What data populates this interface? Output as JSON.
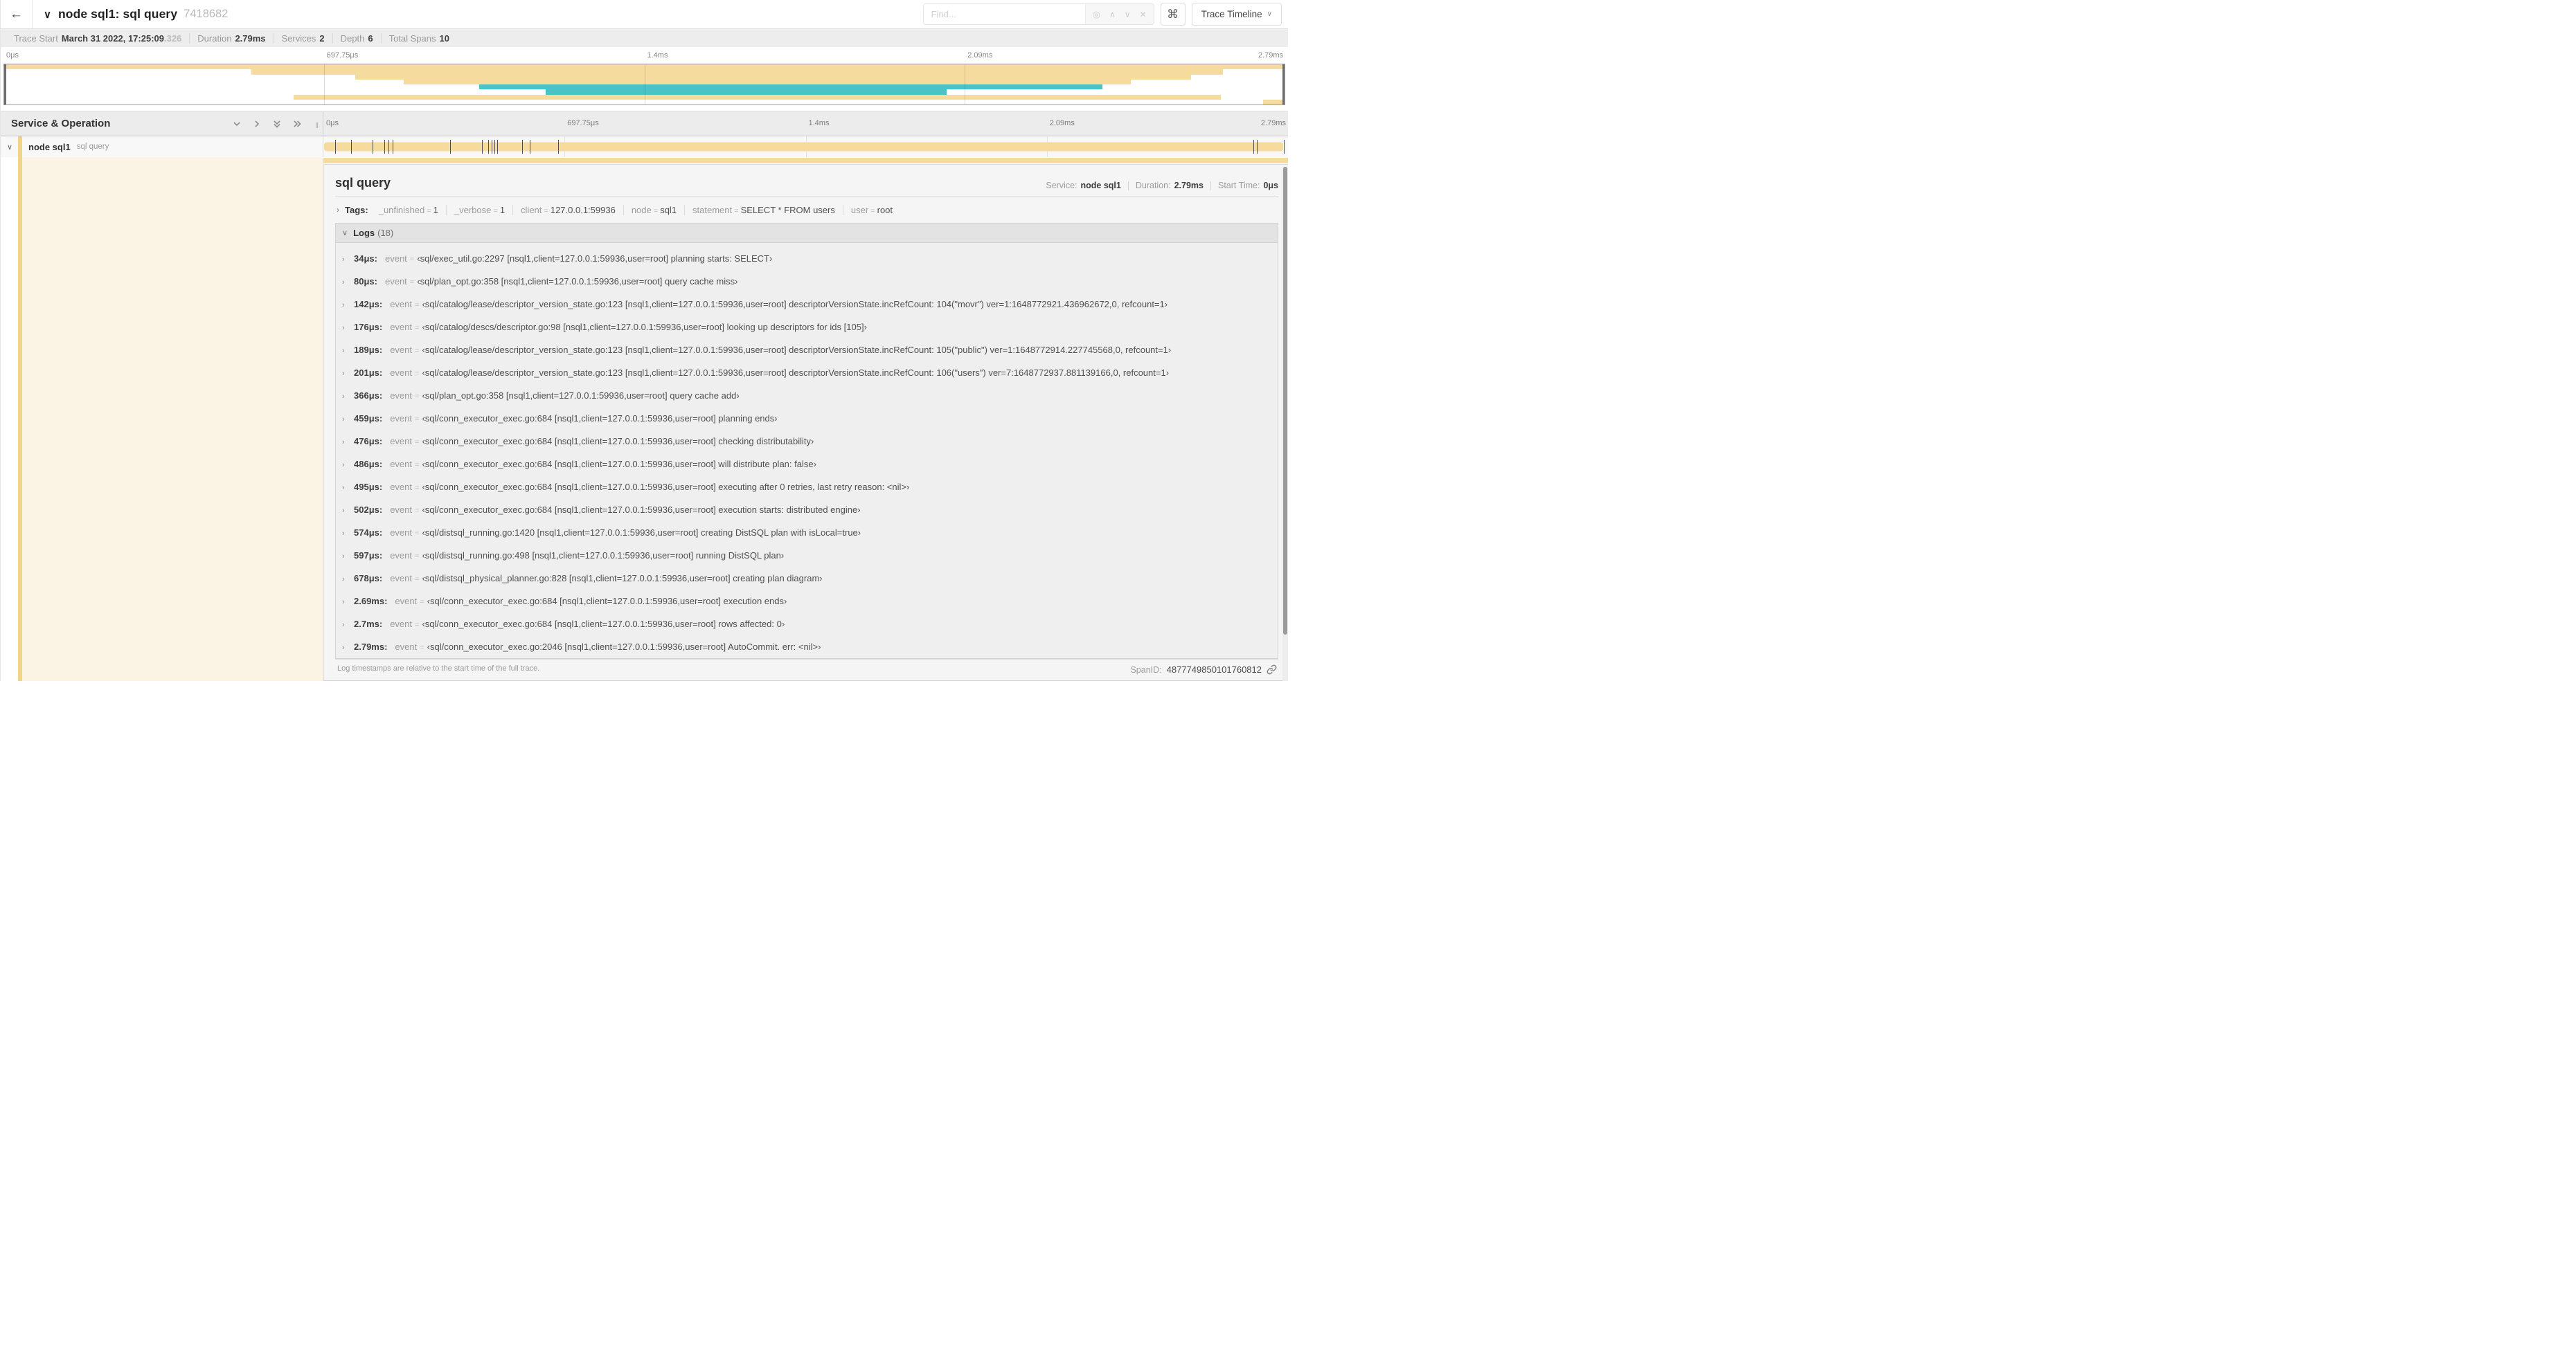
{
  "colors": {
    "bar": "#F6DB9E",
    "accent": "#F2D389",
    "teal": "#48C4C7",
    "cream": "#FBF3E3"
  },
  "header": {
    "back": "←",
    "title": "node sql1: sql query",
    "trace_id": "7418682",
    "find_placeholder": "Find...",
    "view_select": "Trace Timeline",
    "kbd_icon": "⌘"
  },
  "trace_meta": {
    "items": [
      {
        "label": "Trace Start",
        "value": "March 31 2022, 17:25:09",
        "suffix": ".326"
      },
      {
        "label": "Duration",
        "value": "2.79ms",
        "suffix": ""
      },
      {
        "label": "Services",
        "value": "2",
        "suffix": ""
      },
      {
        "label": "Depth",
        "value": "6",
        "suffix": ""
      },
      {
        "label": "Total Spans",
        "value": "10",
        "suffix": ""
      }
    ]
  },
  "timeline": {
    "total_us": 2790,
    "left_header": "Service & Operation",
    "ticks": [
      {
        "label": "0μs",
        "pos": 0
      },
      {
        "label": "697.75μs",
        "pos": 25
      },
      {
        "label": "1.4ms",
        "pos": 50
      },
      {
        "label": "2.09ms",
        "pos": 75
      },
      {
        "label": "2.79ms",
        "pos": 100
      }
    ]
  },
  "minimap": {
    "rows": [
      {
        "start": 0,
        "end": 100,
        "color": "bar"
      },
      {
        "start": 19.3,
        "end": 95.2,
        "color": "bar"
      },
      {
        "start": 27.4,
        "end": 92.7,
        "color": "bar"
      },
      {
        "start": 31.2,
        "end": 88.0,
        "color": "bar"
      },
      {
        "start": 37.1,
        "end": 85.8,
        "color": "teal"
      },
      {
        "start": 42.3,
        "end": 73.6,
        "color": "teal"
      },
      {
        "start": 22.6,
        "end": 95.0,
        "color": "bar"
      },
      {
        "start": 98.3,
        "end": 100,
        "color": "bar"
      }
    ]
  },
  "span": {
    "service": "node sql1",
    "operation": "sql query"
  },
  "detail": {
    "title": "sql query",
    "service_label": "Service:",
    "service": "node sql1",
    "duration_label": "Duration:",
    "duration": "2.79ms",
    "start_label": "Start Time:",
    "start": "0μs",
    "tags_label": "Tags:",
    "tags": [
      {
        "key": "_unfinished",
        "value": "1"
      },
      {
        "key": "_verbose",
        "value": "1"
      },
      {
        "key": "client",
        "value": "127.0.0.1:59936"
      },
      {
        "key": "node",
        "value": "sql1"
      },
      {
        "key": "statement",
        "value": "SELECT * FROM users"
      },
      {
        "key": "user",
        "value": "root"
      }
    ],
    "logs_label": "Logs",
    "logs_count": "(18)",
    "logs": [
      {
        "ts": "34μs:",
        "us": 34,
        "key": "event",
        "value": "‹sql/exec_util.go:2297 [nsql1,client=127.0.0.1:59936,user=root] planning starts: SELECT›"
      },
      {
        "ts": "80μs:",
        "us": 80,
        "key": "event",
        "value": "‹sql/plan_opt.go:358 [nsql1,client=127.0.0.1:59936,user=root] query cache miss›"
      },
      {
        "ts": "142μs:",
        "us": 142,
        "key": "event",
        "value": "‹sql/catalog/lease/descriptor_version_state.go:123 [nsql1,client=127.0.0.1:59936,user=root] descriptorVersionState.incRefCount: 104(\"movr\") ver=1:1648772921.436962672,0, refcount=1›"
      },
      {
        "ts": "176μs:",
        "us": 176,
        "key": "event",
        "value": "‹sql/catalog/descs/descriptor.go:98 [nsql1,client=127.0.0.1:59936,user=root] looking up descriptors for ids [105]›"
      },
      {
        "ts": "189μs:",
        "us": 189,
        "key": "event",
        "value": "‹sql/catalog/lease/descriptor_version_state.go:123 [nsql1,client=127.0.0.1:59936,user=root] descriptorVersionState.incRefCount: 105(\"public\") ver=1:1648772914.227745568,0, refcount=1›"
      },
      {
        "ts": "201μs:",
        "us": 201,
        "key": "event",
        "value": "‹sql/catalog/lease/descriptor_version_state.go:123 [nsql1,client=127.0.0.1:59936,user=root] descriptorVersionState.incRefCount: 106(\"users\") ver=7:1648772937.881139166,0, refcount=1›"
      },
      {
        "ts": "366μs:",
        "us": 366,
        "key": "event",
        "value": "‹sql/plan_opt.go:358 [nsql1,client=127.0.0.1:59936,user=root] query cache add›"
      },
      {
        "ts": "459μs:",
        "us": 459,
        "key": "event",
        "value": "‹sql/conn_executor_exec.go:684 [nsql1,client=127.0.0.1:59936,user=root] planning ends›"
      },
      {
        "ts": "476μs:",
        "us": 476,
        "key": "event",
        "value": "‹sql/conn_executor_exec.go:684 [nsql1,client=127.0.0.1:59936,user=root] checking distributability›"
      },
      {
        "ts": "486μs:",
        "us": 486,
        "key": "event",
        "value": "‹sql/conn_executor_exec.go:684 [nsql1,client=127.0.0.1:59936,user=root] will distribute plan: false›"
      },
      {
        "ts": "495μs:",
        "us": 495,
        "key": "event",
        "value": "‹sql/conn_executor_exec.go:684 [nsql1,client=127.0.0.1:59936,user=root] executing after 0 retries, last retry reason: <nil>›"
      },
      {
        "ts": "502μs:",
        "us": 502,
        "key": "event",
        "value": "‹sql/conn_executor_exec.go:684 [nsql1,client=127.0.0.1:59936,user=root] execution starts: distributed engine›"
      },
      {
        "ts": "574μs:",
        "us": 574,
        "key": "event",
        "value": "‹sql/distsql_running.go:1420 [nsql1,client=127.0.0.1:59936,user=root] creating DistSQL plan with isLocal=true›"
      },
      {
        "ts": "597μs:",
        "us": 597,
        "key": "event",
        "value": "‹sql/distsql_running.go:498 [nsql1,client=127.0.0.1:59936,user=root] running DistSQL plan›"
      },
      {
        "ts": "678μs:",
        "us": 678,
        "key": "event",
        "value": "‹sql/distsql_physical_planner.go:828 [nsql1,client=127.0.0.1:59936,user=root] creating plan diagram›"
      },
      {
        "ts": "2.69ms:",
        "us": 2690,
        "key": "event",
        "value": "‹sql/conn_executor_exec.go:684 [nsql1,client=127.0.0.1:59936,user=root] execution ends›"
      },
      {
        "ts": "2.7ms:",
        "us": 2700,
        "key": "event",
        "value": "‹sql/conn_executor_exec.go:684 [nsql1,client=127.0.0.1:59936,user=root] rows affected: 0›"
      },
      {
        "ts": "2.79ms:",
        "us": 2790,
        "key": "event",
        "value": "‹sql/conn_executor_exec.go:2046 [nsql1,client=127.0.0.1:59936,user=root] AutoCommit. err: <nil>›"
      }
    ],
    "note": "Log timestamps are relative to the start time of the full trace.",
    "span_id_label": "SpanID:",
    "span_id": "4877749850101760812"
  }
}
